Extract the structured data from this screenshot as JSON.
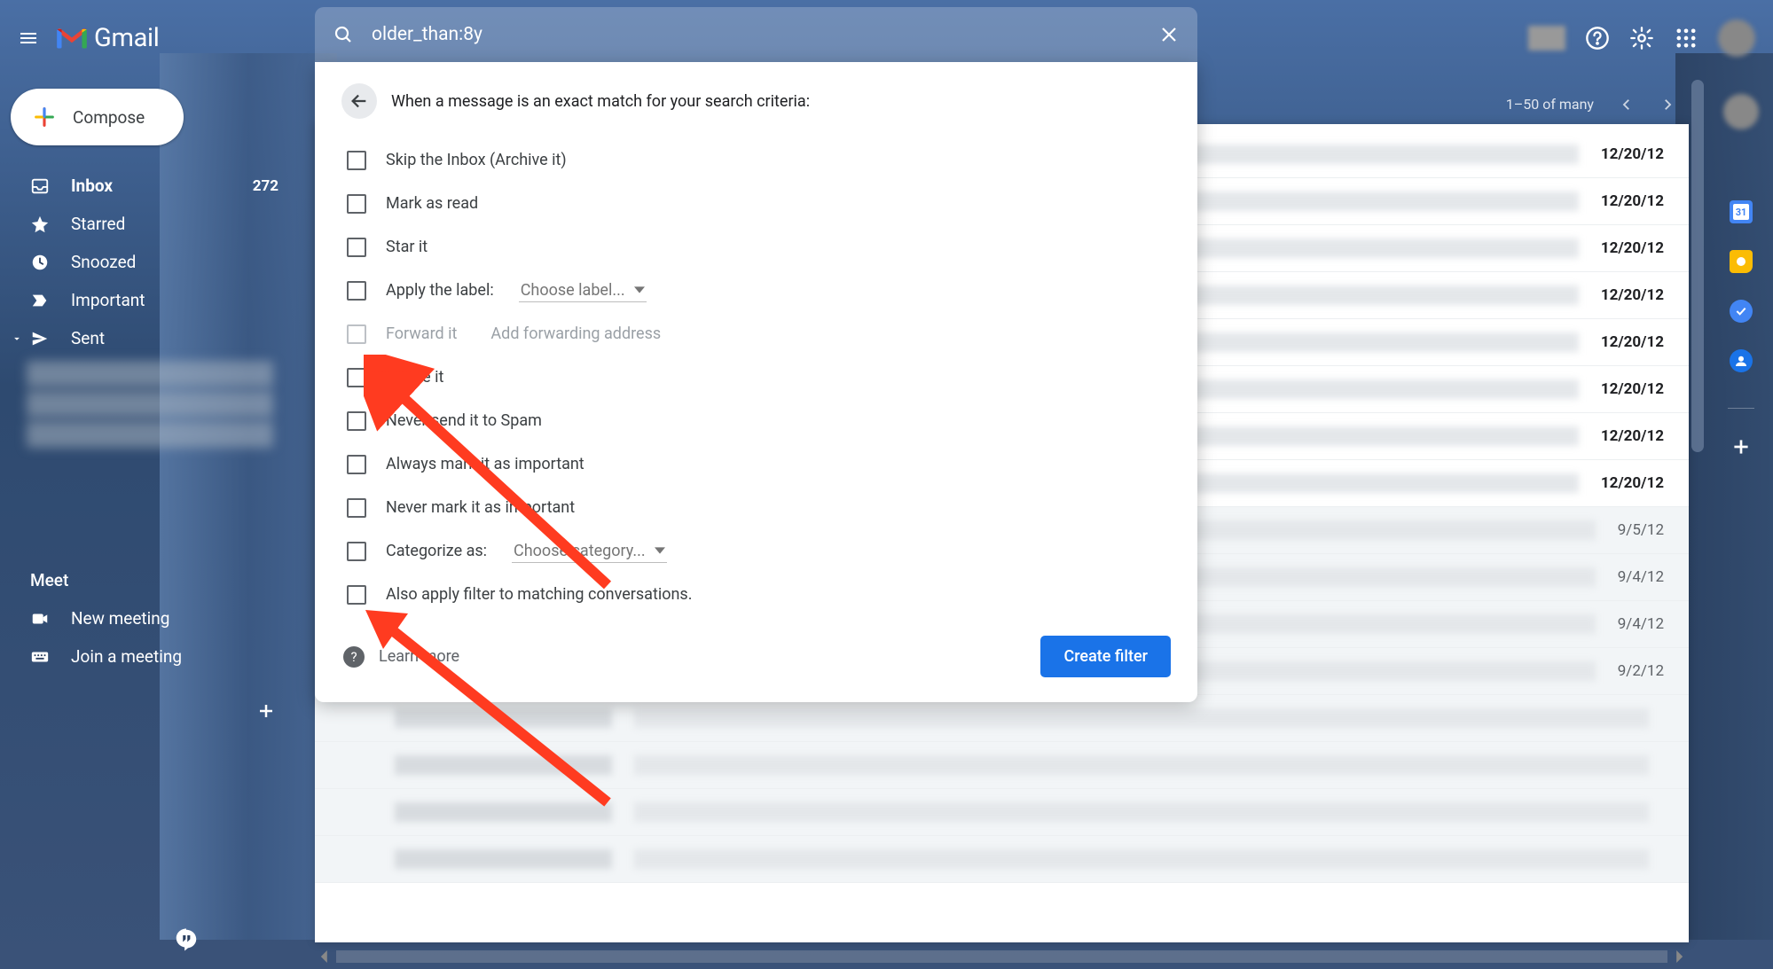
{
  "app": {
    "name": "Gmail"
  },
  "search": {
    "value": "older_than:8y"
  },
  "pager": {
    "range": "1–50 of many"
  },
  "compose": {
    "label": "Compose"
  },
  "nav": {
    "inbox": {
      "label": "Inbox",
      "count": "272"
    },
    "starred": {
      "label": "Starred"
    },
    "snoozed": {
      "label": "Snoozed"
    },
    "important": {
      "label": "Important"
    },
    "sent": {
      "label": "Sent"
    }
  },
  "meet": {
    "header": "Meet",
    "new": "New meeting",
    "join": "Join a meeting"
  },
  "filter": {
    "heading": "When a message is an exact match for your search criteria:",
    "opts": {
      "skip": "Skip the Inbox (Archive it)",
      "read": "Mark as read",
      "star": "Star it",
      "label": "Apply the label:",
      "label_choose": "Choose label...",
      "forward": "Forward it",
      "forward_link": "Add forwarding address",
      "delete": "Delete it",
      "nospam": "Never send it to Spam",
      "important": "Always mark it as important",
      "notimportant": "Never mark it as important",
      "categorize": "Categorize as:",
      "categorize_choose": "Choose category...",
      "also": "Also apply filter to matching conversations."
    },
    "learn_more": "Learn more",
    "create": "Create filter"
  },
  "dates": {
    "d1": "12/20/12",
    "d2": "12/20/12",
    "d3": "12/20/12",
    "d4": "12/20/12",
    "d5": "12/20/12",
    "d6": "12/20/12",
    "d7": "12/20/12",
    "d8": "12/20/12",
    "d9": "9/5/12",
    "d10": "9/4/12",
    "d11": "9/4/12",
    "d12": "9/2/12"
  }
}
